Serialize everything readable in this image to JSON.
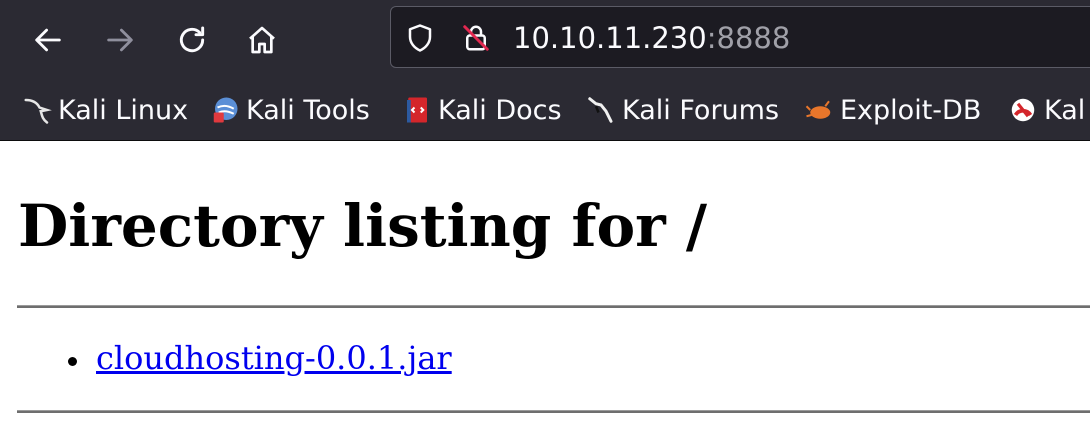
{
  "browser": {
    "nav": {
      "back_icon": "arrow-left-icon",
      "forward_icon": "arrow-right-icon",
      "reload_icon": "reload-icon",
      "home_icon": "home-icon"
    },
    "urlbar": {
      "host": "10.10.11.230",
      "port": ":8888",
      "tracking_icon": "shield-icon",
      "security_icon": "insecure-lock-icon"
    },
    "bookmarks": [
      {
        "label": "Kali Linux",
        "icon": "kali-dragon-icon"
      },
      {
        "label": "Kali Tools",
        "icon": "kali-tools-icon"
      },
      {
        "label": "Kali Docs",
        "icon": "kali-docs-icon"
      },
      {
        "label": "Kali Forums",
        "icon": "kali-forums-icon"
      },
      {
        "label": "Exploit-DB",
        "icon": "exploit-db-icon"
      },
      {
        "label": "Kal",
        "icon": "kali-nethunter-icon"
      }
    ]
  },
  "page": {
    "heading": "Directory listing for /",
    "files": [
      {
        "name": "cloudhosting-0.0.1.jar"
      }
    ]
  },
  "colors": {
    "toolbar_bg": "#2b2a33",
    "urlbar_bg": "#1c1b22",
    "link": "#0000ee"
  }
}
